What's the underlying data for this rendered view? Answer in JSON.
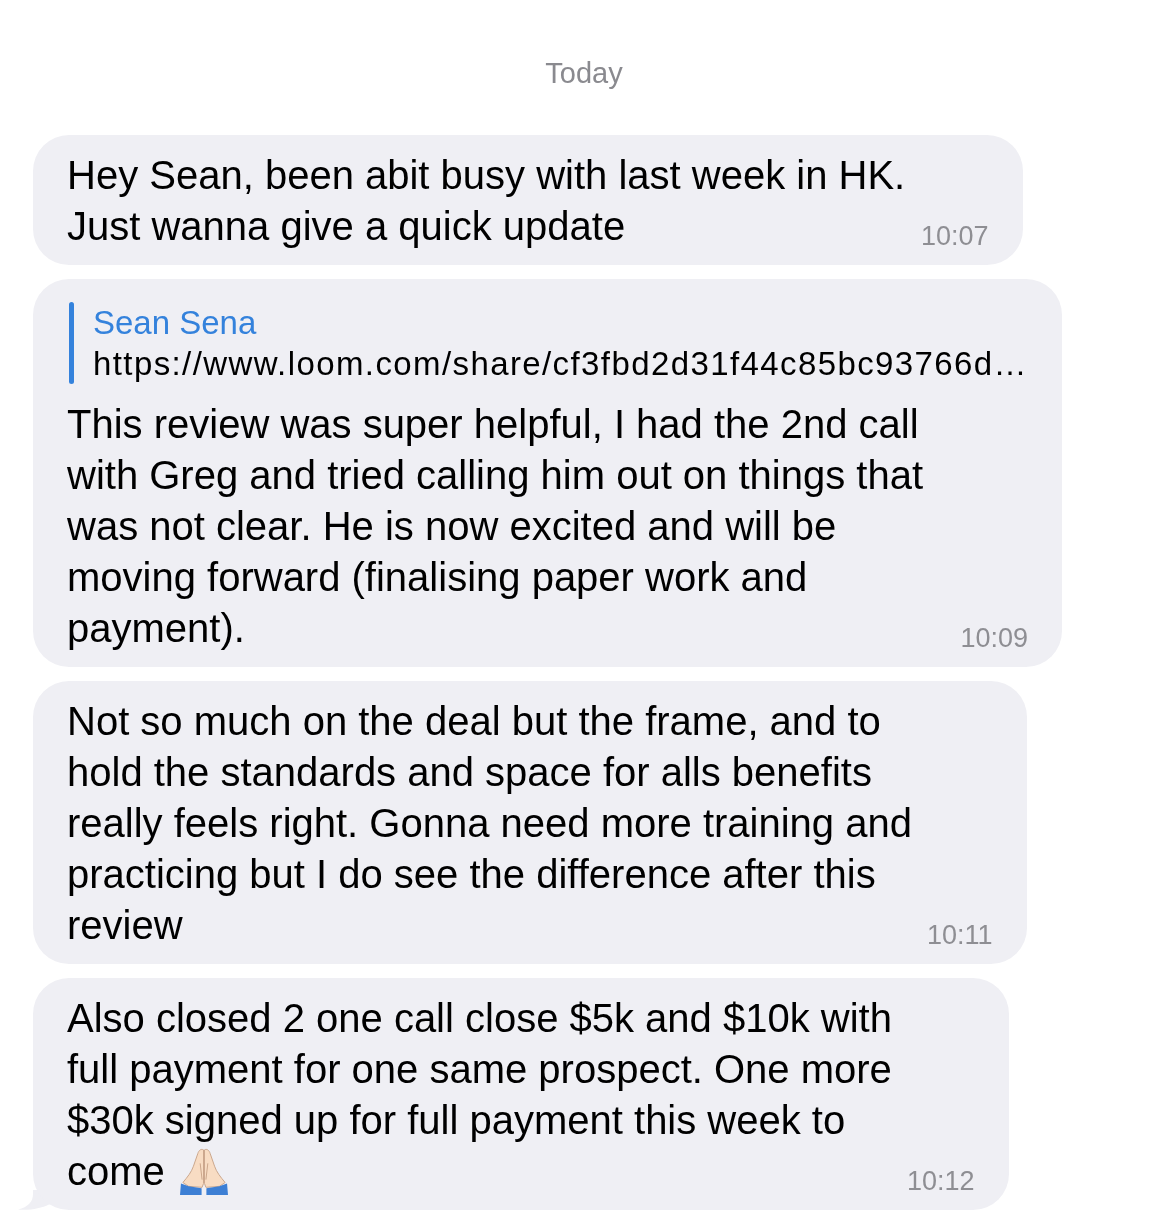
{
  "date_divider": "Today",
  "messages": [
    {
      "text": "Hey Sean, been abit busy with last week in HK. Just wanna give a quick update",
      "time": "10:07"
    },
    {
      "reply": {
        "author": "Sean Sena",
        "preview": "https://www.loom.com/share/cf3fbd2d31f44c85bc93766d…"
      },
      "text": "This review was super helpful, I had the 2nd call with Greg and tried calling him out on things that was not clear. He is now excited and will be moving forward (finalising paper work and payment).",
      "time": "10:09"
    },
    {
      "text": "Not so much on the deal but the frame, and to hold the standards and space for alls benefits really feels right. Gonna need more training and practicing but I do see the difference after this review",
      "time": "10:11"
    },
    {
      "text": "Also closed 2 one call close $5k and $10k with full payment for one same prospect. One more $30k signed up for full payment this week to come",
      "time": "10:12",
      "emoji": true,
      "tail": true
    }
  ]
}
